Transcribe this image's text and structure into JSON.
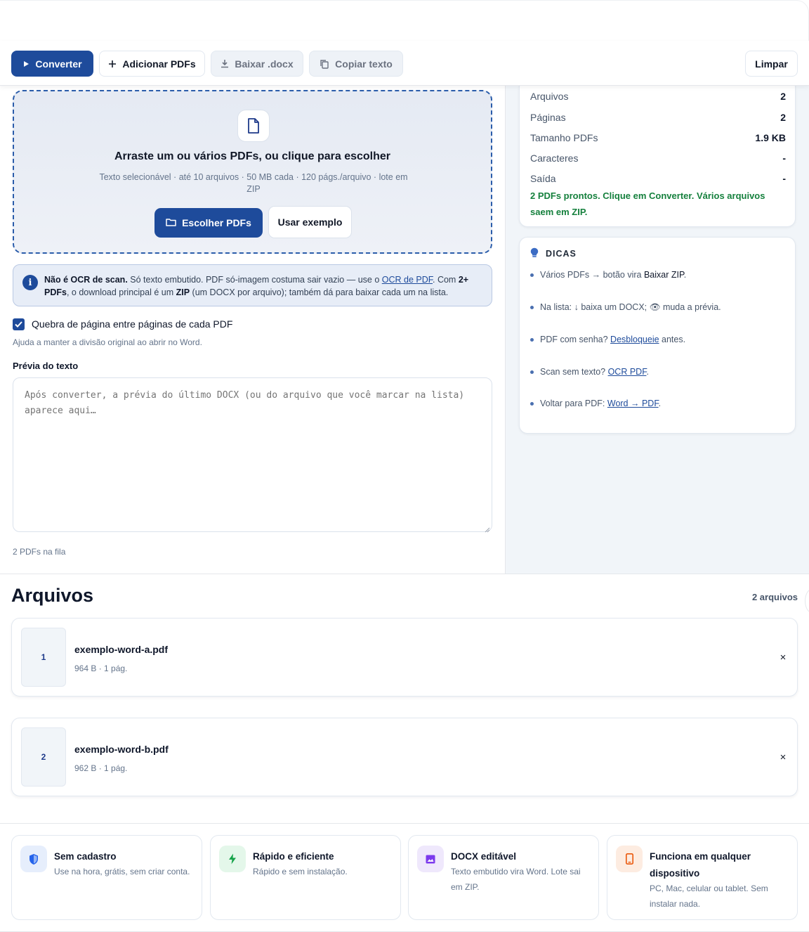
{
  "toolbar": {
    "convert_label": "Converter",
    "add_label": "Adicionar PDFs",
    "download_label": "Baixar .docx",
    "copy_label": "Copiar texto",
    "clear_label": "Limpar"
  },
  "dropzone": {
    "title": "Arraste um ou vários PDFs, ou clique para escolher",
    "subtitle": "Texto selecionável · até 10 arquivos · 50 MB cada · 120 págs./arquivo · lote em ZIP",
    "choose_label": "Escolher PDFs",
    "example_label": "Usar exemplo"
  },
  "notice": {
    "bold_1": "Não é OCR de scan.",
    "text_1": " Só texto embutido. PDF só-imagem costuma sair vazio — use o ",
    "link_1": "OCR de PDF",
    "text_2": ". Com ",
    "bold_2": "2+ PDFs",
    "text_3": ", o download principal é um ",
    "bold_3": "ZIP",
    "text_4": " (um DOCX por arquivo); também dá para baixar cada um na lista."
  },
  "options": {
    "page_break_label": "Quebra de página entre páginas de cada PDF",
    "page_break_checked": true,
    "page_break_help": "Ajuda a manter a divisão original ao abrir no Word."
  },
  "preview": {
    "label": "Prévia do texto",
    "placeholder": "Após converter, a prévia do último DOCX (ou do arquivo que você marcar na lista) aparece aqui…",
    "queue_status": "2 PDFs na fila"
  },
  "stats": {
    "rows": [
      {
        "key": "Arquivos",
        "value": "2"
      },
      {
        "key": "Páginas",
        "value": "2"
      },
      {
        "key": "Tamanho PDFs",
        "value": "1.9 KB"
      },
      {
        "key": "Caracteres",
        "value": "-"
      },
      {
        "key": "Saída",
        "value": "-"
      }
    ],
    "status": "2 PDFs prontos. Clique em Converter. Vários arquivos saem em ZIP."
  },
  "tips": {
    "heading": "DICAS",
    "items": [
      {
        "pre": "Vários PDFs → botão vira ",
        "bold": "Baixar ZIP",
        "post": "."
      },
      {
        "pre": "Na lista: ↓ baixa um DOCX; 👁 muda a prévia."
      },
      {
        "pre": "PDF com senha? ",
        "link": "Desbloqueie",
        "post": " antes."
      },
      {
        "pre": "Scan sem texto? ",
        "link": "OCR PDF",
        "post": "."
      },
      {
        "pre": "Voltar para PDF: ",
        "link": "Word → PDF",
        "post": "."
      }
    ]
  },
  "files": {
    "title": "Arquivos",
    "count": "2 arquivos",
    "items": [
      {
        "index": "1",
        "name": "exemplo-word-a.pdf",
        "meta": "964 B · 1 pág.",
        "remove": "×"
      },
      {
        "index": "2",
        "name": "exemplo-word-b.pdf",
        "meta": "962 B · 1 pág.",
        "remove": "×"
      }
    ]
  },
  "features": [
    {
      "title": "Sem cadastro",
      "desc": "Use na hora, grátis, sem criar conta.",
      "icon": "shield-icon",
      "color": "#2563eb"
    },
    {
      "title": "Rápido e eficiente",
      "desc": "Rápido e sem instalação.",
      "icon": "bolt-icon",
      "color": "#16a34a"
    },
    {
      "title": "DOCX editável",
      "desc": "Texto embutido vira Word. Lote sai em ZIP.",
      "icon": "image-icon",
      "color": "#7c3aed"
    },
    {
      "title": "Funciona em qualquer dispositivo",
      "desc": "PC, Mac, celular ou tablet. Sem instalar nada.",
      "icon": "phone-icon",
      "color": "#ea580c"
    }
  ],
  "colors": {
    "primary": "#1e4b9b",
    "success": "#15803d"
  }
}
